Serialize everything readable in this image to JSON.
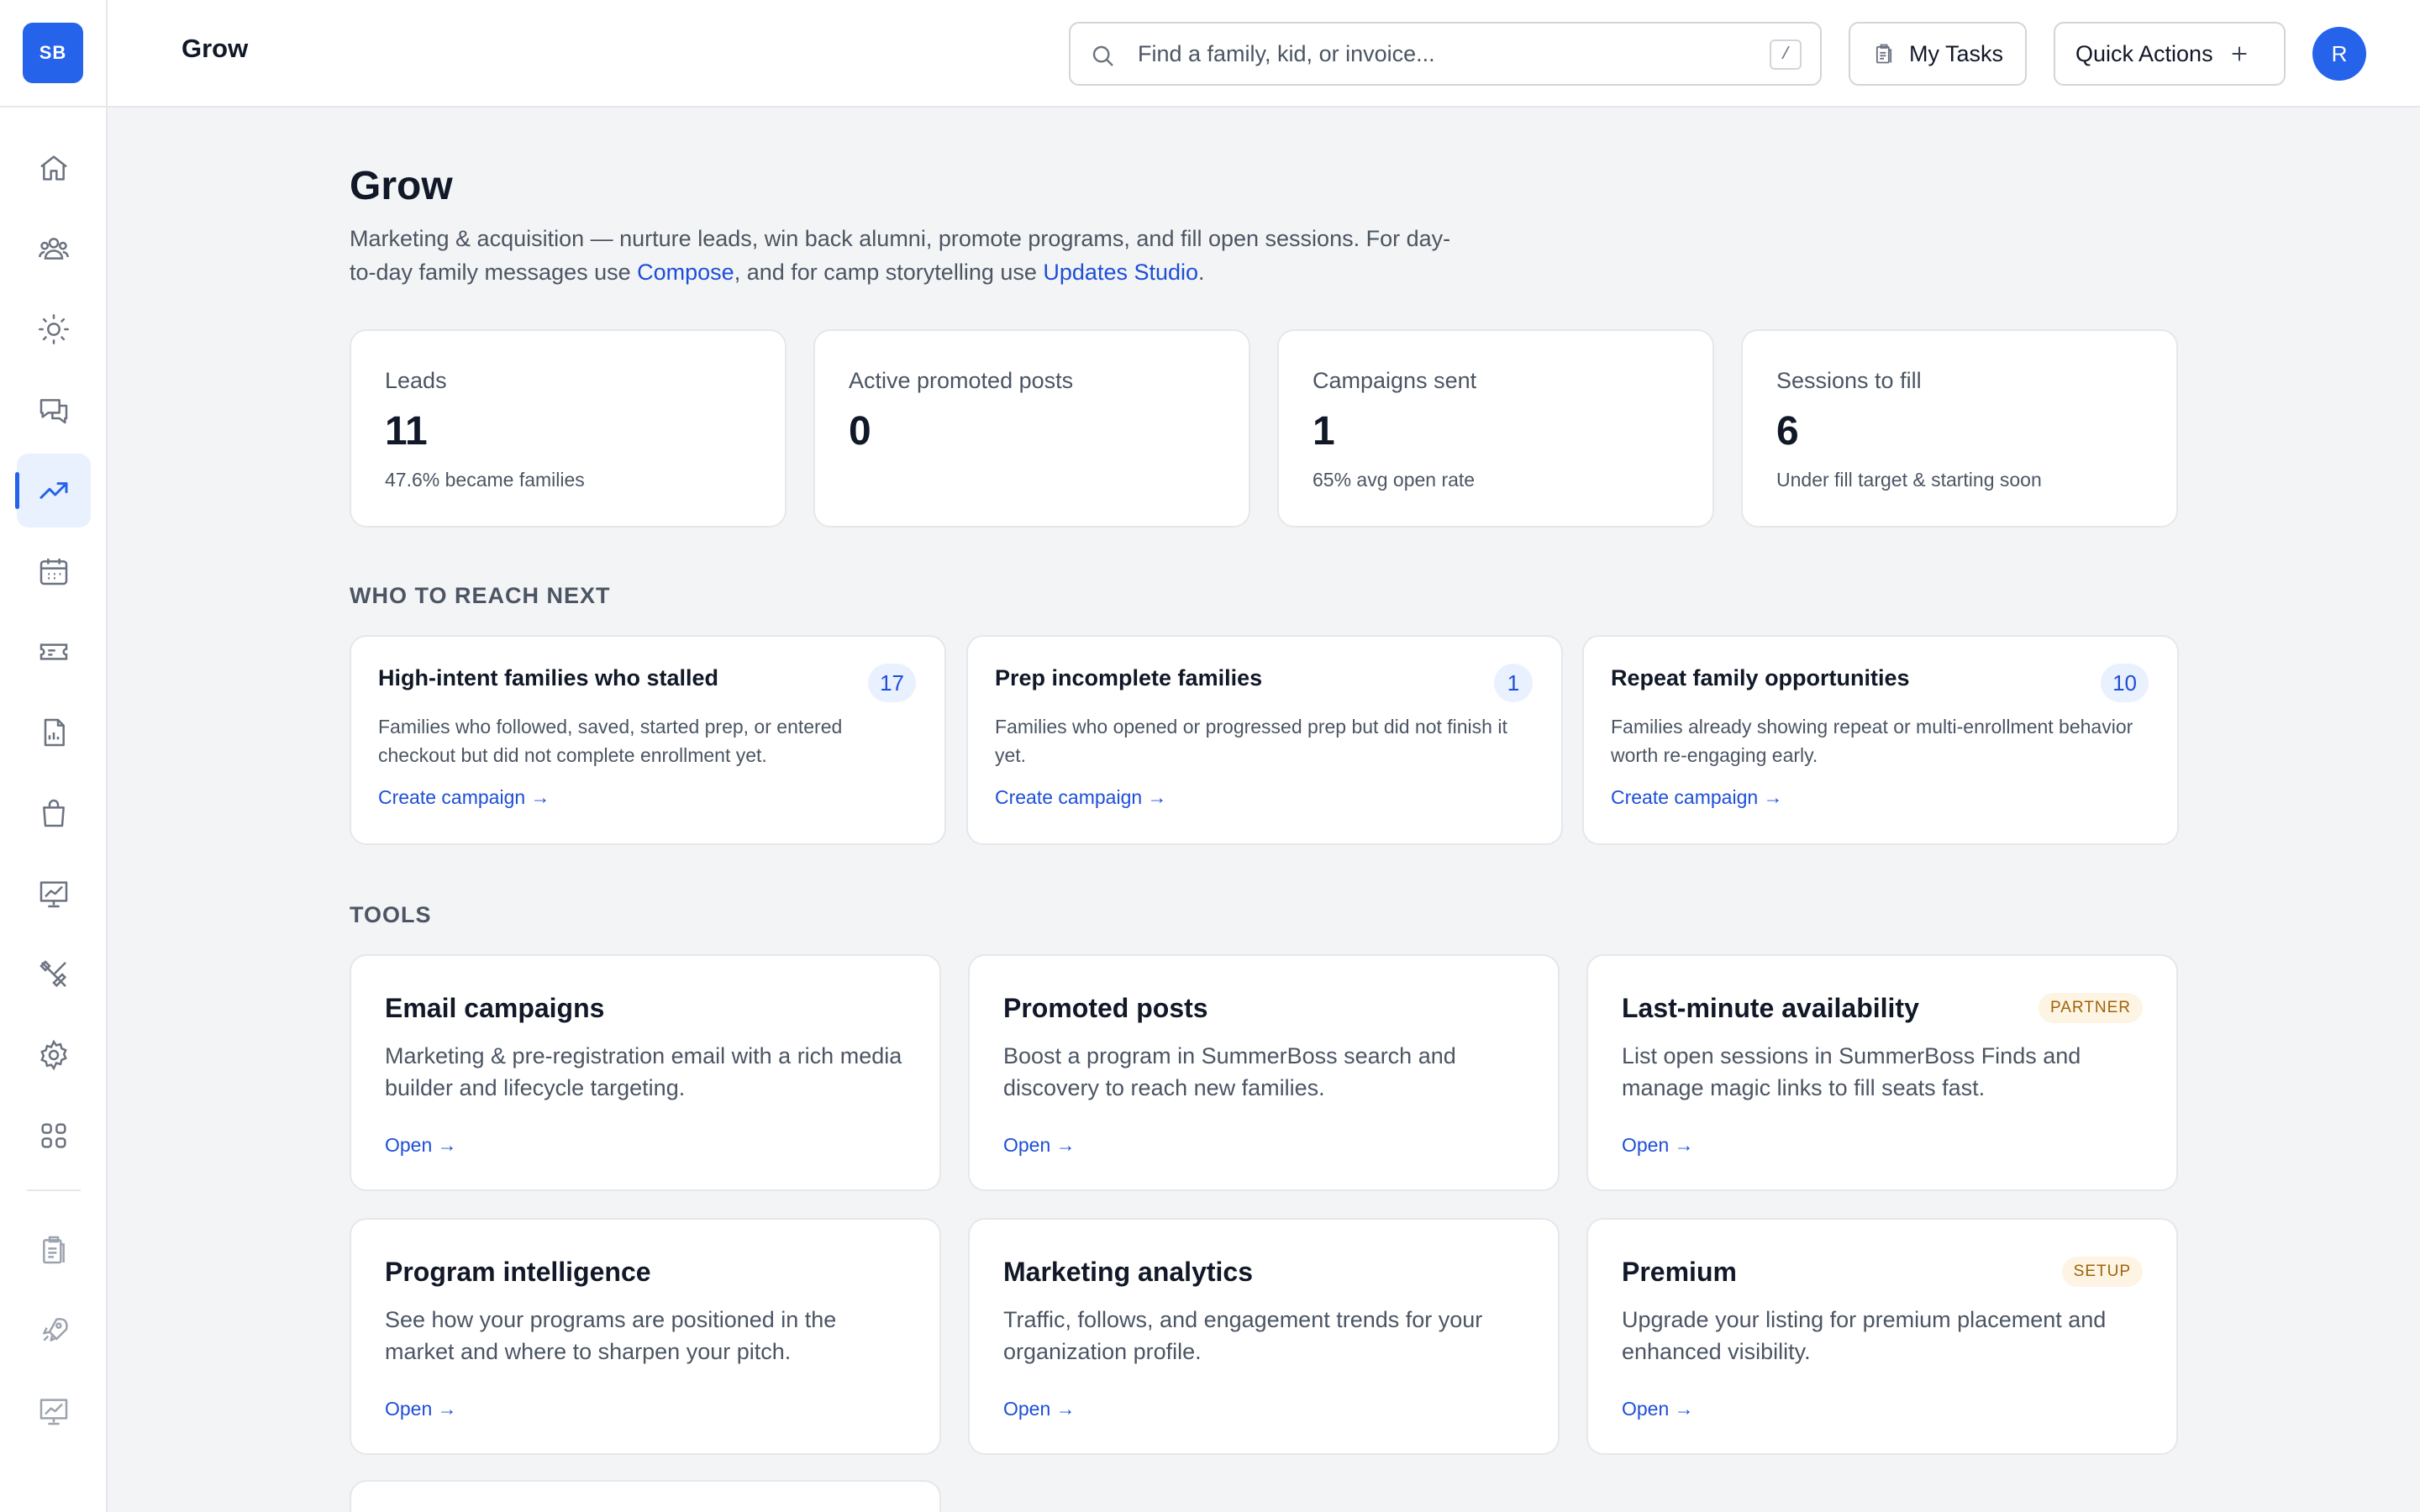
{
  "sidebar": {
    "logo": "SB",
    "items": [
      {
        "icon": "home-icon"
      },
      {
        "icon": "people-icon"
      },
      {
        "icon": "sun-icon"
      },
      {
        "icon": "chat-icon"
      },
      {
        "icon": "trending-icon",
        "active": true
      },
      {
        "icon": "calendar-icon"
      },
      {
        "icon": "ticket-icon"
      },
      {
        "icon": "report-icon"
      },
      {
        "icon": "bag-icon"
      },
      {
        "icon": "chart-board-icon"
      },
      {
        "icon": "tools-icon"
      },
      {
        "icon": "gear-icon"
      },
      {
        "icon": "apps-icon"
      },
      {
        "icon": "clipboard-icon"
      },
      {
        "icon": "rocket-icon"
      },
      {
        "icon": "presentation-icon"
      }
    ]
  },
  "topbar": {
    "title": "Grow",
    "search_placeholder": "Find a family, kid, or invoice...",
    "search_shortcut": "/",
    "tasks_label": "My Tasks",
    "quick_actions_label": "Quick Actions",
    "avatar_initial": "R"
  },
  "page": {
    "title": "Grow",
    "desc_prefix": "Marketing & acquisition — nurture leads, win back alumni, promote programs, and fill open sessions. For day-to-day family messages use ",
    "compose_link": "Compose",
    "desc_middle": ", and for camp storytelling use ",
    "studio_link": "Updates Studio",
    "desc_suffix": "."
  },
  "stats": [
    {
      "label": "Leads",
      "value": "11",
      "sub": "47.6% became families"
    },
    {
      "label": "Active promoted posts",
      "value": "0",
      "sub": ""
    },
    {
      "label": "Campaigns sent",
      "value": "1",
      "sub": "65% avg open rate"
    },
    {
      "label": "Sessions to fill",
      "value": "6",
      "sub": "Under fill target & starting soon"
    }
  ],
  "reach_section_label": "WHO TO REACH NEXT",
  "reach": [
    {
      "title": "High-intent families who stalled",
      "count": "17",
      "desc": "Families who followed, saved, started prep, or entered checkout but did not complete enrollment yet.",
      "link": "Create campaign →"
    },
    {
      "title": "Prep incomplete families",
      "count": "1",
      "desc": "Families who opened or progressed prep but did not finish it yet.",
      "link": "Create campaign →"
    },
    {
      "title": "Repeat family opportunities",
      "count": "10",
      "desc": "Families already showing repeat or multi-enrollment behavior worth re-engaging early.",
      "link": "Create campaign →"
    }
  ],
  "tools_section_label": "TOOLS",
  "tools": [
    {
      "title": "Email campaigns",
      "desc": "Marketing & pre-registration email with a rich media builder and lifecycle targeting.",
      "link": "Open →",
      "badge": ""
    },
    {
      "title": "Promoted posts",
      "desc": "Boost a program in SummerBoss search and discovery to reach new families.",
      "link": "Open →",
      "badge": ""
    },
    {
      "title": "Last-minute availability",
      "desc": "List open sessions in SummerBoss Finds and manage magic links to fill seats fast.",
      "link": "Open →",
      "badge": "PARTNER"
    },
    {
      "title": "Program intelligence",
      "desc": "See how your programs are positioned in the market and where to sharpen your pitch.",
      "link": "Open →",
      "badge": ""
    },
    {
      "title": "Marketing analytics",
      "desc": "Traffic, follows, and engagement trends for your organization profile.",
      "link": "Open →",
      "badge": ""
    },
    {
      "title": "Premium",
      "desc": "Upgrade your listing for premium placement and enhanced visibility.",
      "link": "Open →",
      "badge": "SETUP"
    }
  ],
  "colors": {
    "accent": "#2563eb",
    "link": "#1d4ed8",
    "badge_bg": "#fdf4e3",
    "badge_text": "#a16207"
  }
}
